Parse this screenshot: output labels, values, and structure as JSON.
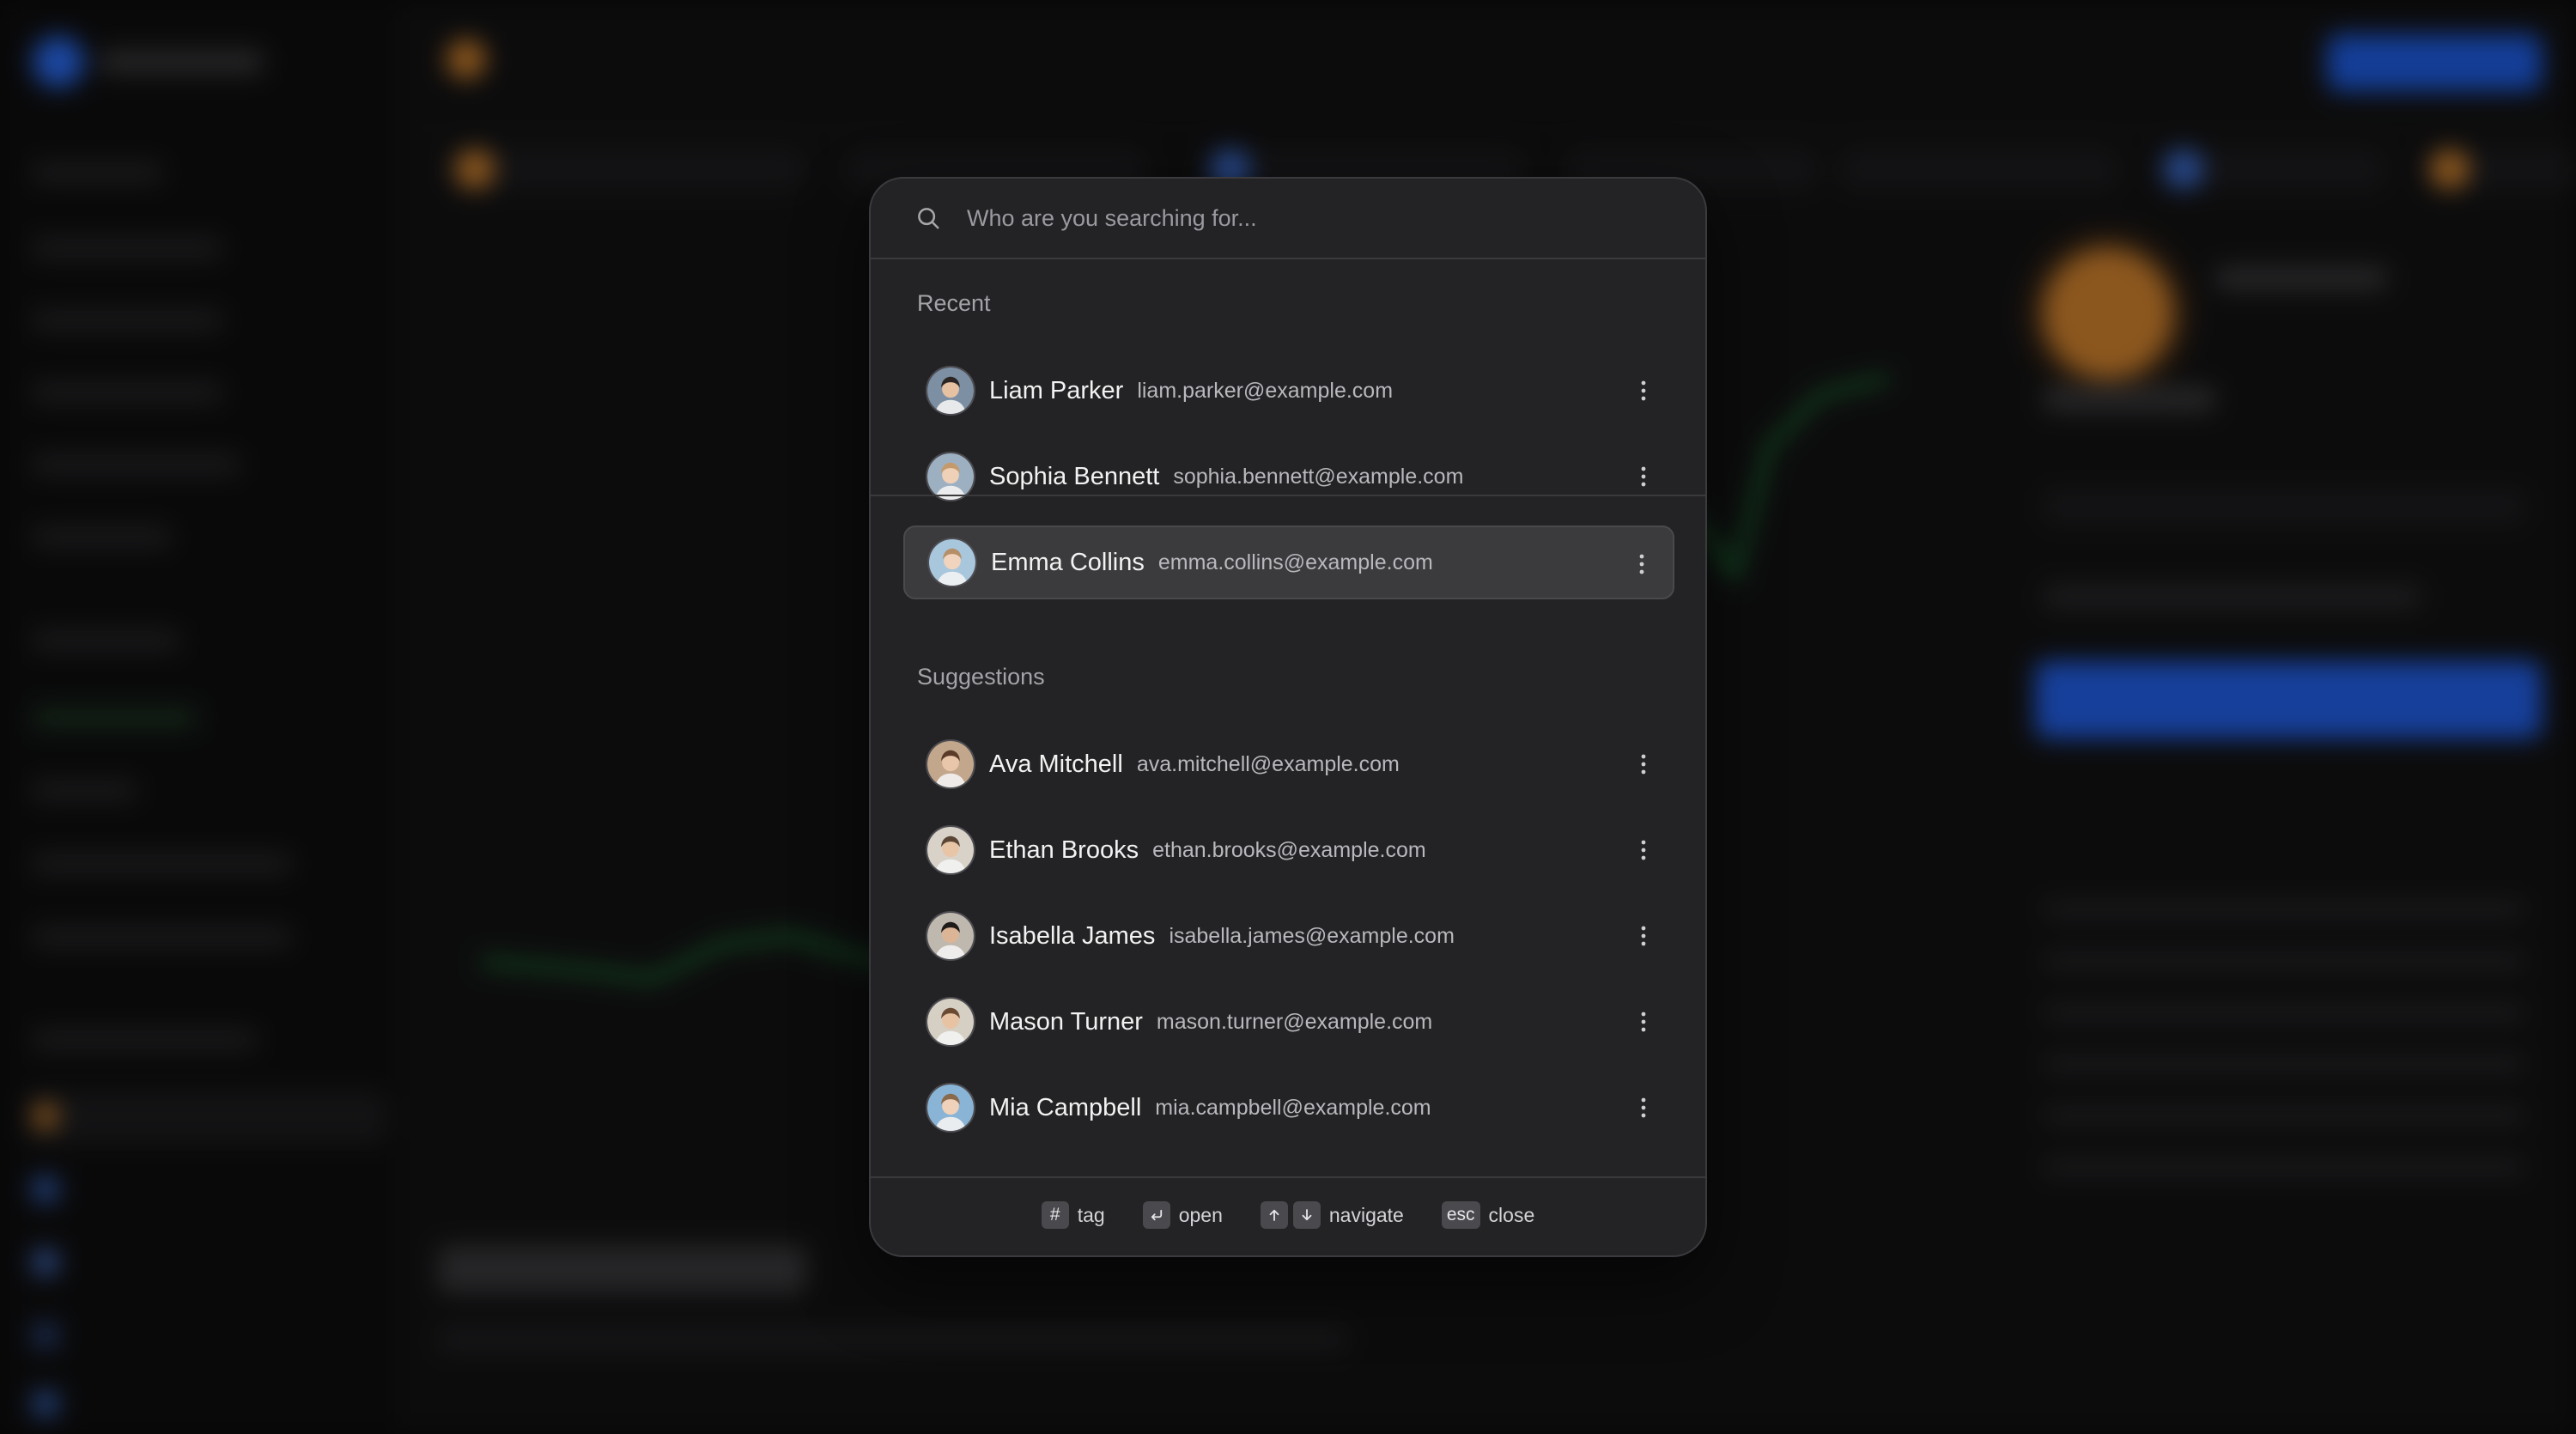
{
  "search": {
    "placeholder": "Who are you searching for..."
  },
  "sections": {
    "recent_label": "Recent",
    "suggestions_label": "Suggestions"
  },
  "recent": [
    {
      "name": "Liam Parker",
      "email": "liam.parker@example.com",
      "selected": false
    },
    {
      "name": "Sophia Bennett",
      "email": "sophia.bennett@example.com",
      "selected": false
    },
    {
      "name": "Emma Collins",
      "email": "emma.collins@example.com",
      "selected": true
    }
  ],
  "suggestions": [
    {
      "name": "Ava Mitchell",
      "email": "ava.mitchell@example.com"
    },
    {
      "name": "Ethan Brooks",
      "email": "ethan.brooks@example.com"
    },
    {
      "name": "Isabella James",
      "email": "isabella.james@example.com"
    },
    {
      "name": "Mason Turner",
      "email": "mason.turner@example.com"
    },
    {
      "name": "Mia Campbell",
      "email": "mia.campbell@example.com"
    }
  ],
  "footer": {
    "tag_key": "#",
    "tag_label": "tag",
    "open_label": "open",
    "navigate_label": "navigate",
    "close_key": "esc",
    "close_label": "close"
  },
  "colors": {
    "palette_bg": "#232325",
    "selected_row": "#3b3b3e",
    "accent_blue": "#2362ee",
    "coin_orange": "#d7862f"
  }
}
